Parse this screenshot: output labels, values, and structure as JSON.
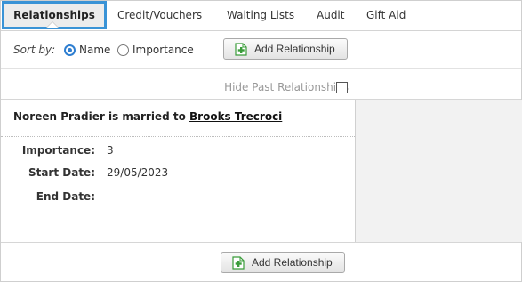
{
  "tabs": [
    {
      "label": "Relationships",
      "active": true
    },
    {
      "label": "Credit/Vouchers"
    },
    {
      "label": "Waiting Lists"
    },
    {
      "label": "Audit"
    },
    {
      "label": "Gift Aid"
    }
  ],
  "sort": {
    "label": "Sort by:",
    "options": [
      {
        "label": "Name",
        "checked": true
      },
      {
        "label": "Importance",
        "checked": false
      }
    ]
  },
  "add_button_label": "Add Relationship",
  "add_button_icon": "add-document-icon",
  "hide_past": {
    "label": "Hide Past Relationships",
    "checked": false
  },
  "relationship": {
    "prefix": "Noreen Pradier is married to",
    "link": "Brooks Trecroci",
    "fields": [
      {
        "label": "Importance:",
        "value": "3"
      },
      {
        "label": "Start Date:",
        "value": "29/05/2023"
      },
      {
        "label": "End Date:",
        "value": ""
      }
    ]
  },
  "colors": {
    "accent": "#3a93d6",
    "radio": "#2f7fd1",
    "icon_green": "#3a9c3a"
  }
}
